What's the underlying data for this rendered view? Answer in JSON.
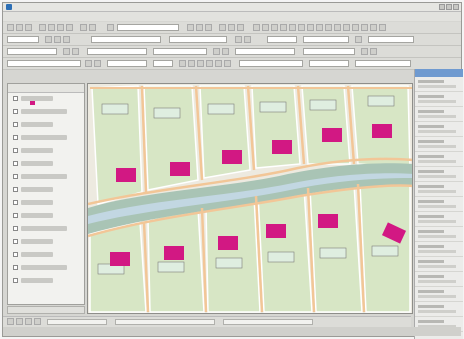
{
  "colors": {
    "building": "#d21883",
    "lot": "#d7e6c5",
    "street": "#f2c697",
    "creek_bank": "#a9c4b5",
    "creek": "#c2d7e2",
    "parcel_line": "#ffffff",
    "label_box": "#dfeee0"
  },
  "icons": {
    "app": "app-icon",
    "layer_toggle": "checkbox-icon",
    "minimize": "minimize-icon",
    "maximize": "maximize-icon",
    "close": "close-icon"
  }
}
